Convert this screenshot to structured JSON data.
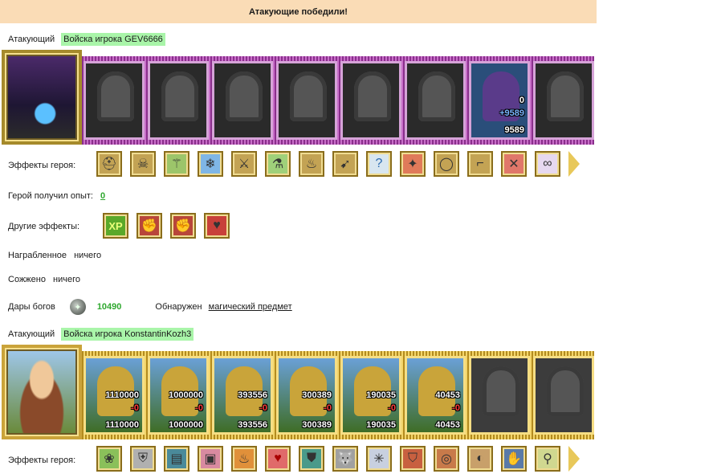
{
  "banner": "Атакующие победили!",
  "side1": {
    "role": "Атакующий",
    "player": "Войска игрока GEV6666",
    "hero_icon": "dark-mage-hero-icon",
    "units": [
      {
        "icon": "golem-icon"
      },
      {
        "icon": "swordsman-icon"
      },
      {
        "icon": "knight-icon"
      },
      {
        "icon": "griffin-icon"
      },
      {
        "icon": "archer-icon"
      },
      {
        "icon": "dark-priest-icon"
      },
      {
        "icon": "lich-icon",
        "count_top": "0",
        "count_gain": "+9589",
        "count_bottom": "9589"
      },
      {
        "icon": "dark-champion-icon"
      }
    ]
  },
  "effects1": {
    "label": "Эффекты героя:",
    "icons": [
      "helm-effect-icon",
      "skull-shield-effect-icon",
      "staff-effect-icon",
      "frost-orb-effect-icon",
      "swords-effect-icon",
      "potion-effect-icon",
      "lantern-effect-icon",
      "crossbow-effect-icon",
      "unknown-effect-icon",
      "amulet-effect-icon",
      "ring-effect-icon",
      "boots-effect-icon",
      "crossed-weapons-effect-icon",
      "chain-effect-icon"
    ]
  },
  "xp": {
    "label": "Герой получил опыт:",
    "value": "0"
  },
  "other": {
    "label": "Другие эффекты:",
    "icons": [
      "xp-bonus-icon",
      "attack-boost-icon",
      "attack-boost-2-icon",
      "heart-shield-icon"
    ],
    "xp_text": "XP"
  },
  "loot": {
    "label": "Награбленное",
    "value": "ничего"
  },
  "burned": {
    "label": "Сожжено",
    "value": "ничего"
  },
  "gifts": {
    "label": "Дары богов",
    "value": "10490",
    "found_label": "Обнаружен",
    "found_item": "магический предмет"
  },
  "side2": {
    "role": "Атакующий",
    "player": "Войска игрока KonstantinKozh3",
    "hero_icon": "huntress-hero-icon",
    "units": [
      {
        "icon": "peasant-unit-icon",
        "count_top": "1110000",
        "count_red": "-0",
        "count_bottom": "1110000"
      },
      {
        "icon": "gold-knight-unit-icon",
        "count_top": "1000000",
        "count_red": "-0",
        "count_bottom": "1000000"
      },
      {
        "icon": "cavalier-unit-icon",
        "count_top": "393556",
        "count_red": "-0",
        "count_bottom": "393556"
      },
      {
        "icon": "paladin-unit-icon",
        "count_top": "300389",
        "count_red": "-0",
        "count_bottom": "300389"
      },
      {
        "icon": "archer-unit-icon",
        "count_top": "190035",
        "count_red": "-0",
        "count_bottom": "190035"
      },
      {
        "icon": "cleric-unit-icon",
        "count_top": "40453",
        "count_red": "-0",
        "count_bottom": "40453"
      },
      {
        "icon": "armored-golem-unit-icon"
      },
      {
        "icon": "hooded-mage-unit-icon"
      }
    ]
  },
  "effects2": {
    "label": "Эффекты героя:",
    "icons": [
      "nature-orb-effect-icon",
      "armor-effect-icon",
      "spellbook-effect-icon",
      "chest-effect-icon",
      "fire-chest-effect-icon",
      "heart-effect-icon",
      "shield-effect-icon",
      "wolf-effect-icon",
      "web-effect-icon",
      "cuirass-effect-icon",
      "belt-effect-icon",
      "bracer-effect-icon",
      "gauntlet-effect-icon",
      "wand-effect-icon"
    ]
  }
}
